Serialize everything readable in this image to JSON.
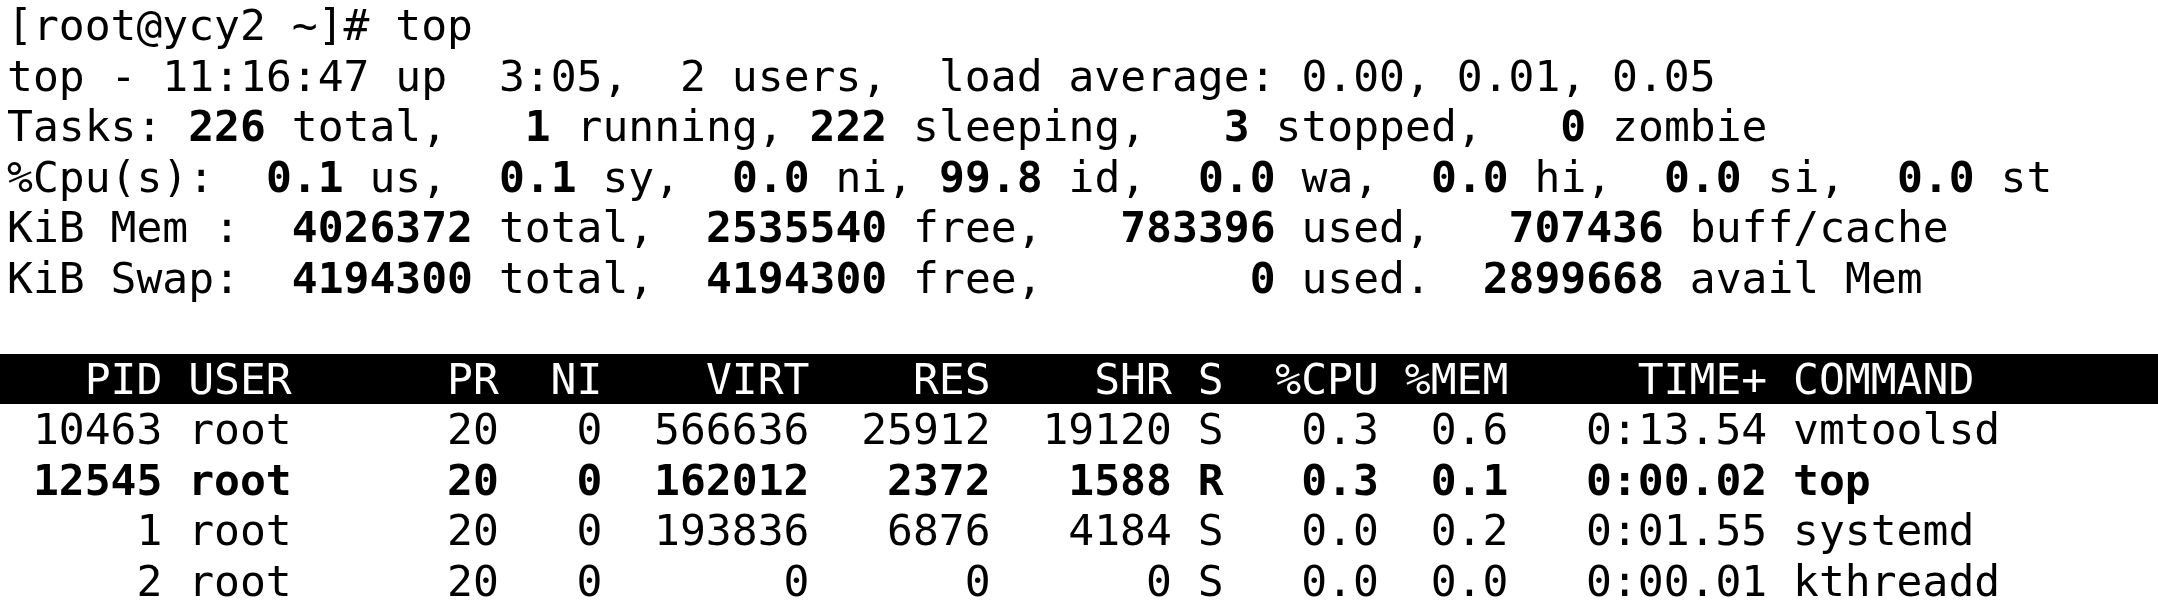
{
  "prompt": "[root@ycy2 ~]# top",
  "summary": [
    "top - 11:16:47 up  3:05,  2 users,  load average: 0.00, 0.01, 0.05",
    "Tasks: **226** total,   **1** running, **222** sleeping,   **3** stopped,   **0** zombie",
    "%Cpu(s):  **0.1** us,  **0.1** sy,  **0.0** ni, **99.8** id,  **0.0** wa,  **0.0** hi,  **0.0** si,  **0.0** st",
    "KiB Mem :  **4026372** total,  **2535540** free,   **783396** used,   **707436** buff/cache",
    "KiB Swap:  **4194300** total,  **4194300** free,        **0** used.  **2899668** avail Mem"
  ],
  "table": {
    "columns": [
      "PID",
      "USER",
      "PR",
      "NI",
      "VIRT",
      "RES",
      "SHR",
      "S",
      "%CPU",
      "%MEM",
      "TIME+",
      "COMMAND"
    ],
    "rows": [
      {
        "cells": [
          "10463",
          "root",
          "20",
          "0",
          "566636",
          "25912",
          "19120",
          "S",
          "0.3",
          "0.6",
          "0:13.54",
          "vmtoolsd"
        ],
        "highlighted": false
      },
      {
        "cells": [
          "12545",
          "root",
          "20",
          "0",
          "162012",
          "2372",
          "1588",
          "R",
          "0.3",
          "0.1",
          "0:00.02",
          "top"
        ],
        "highlighted": true
      },
      {
        "cells": [
          "1",
          "root",
          "20",
          "0",
          "193836",
          "6876",
          "4184",
          "S",
          "0.0",
          "0.2",
          "0:01.55",
          "systemd"
        ],
        "highlighted": false
      },
      {
        "cells": [
          "2",
          "root",
          "20",
          "0",
          "0",
          "0",
          "0",
          "S",
          "0.0",
          "0.0",
          "0:00.01",
          "kthreadd"
        ],
        "highlighted": false
      }
    ]
  }
}
